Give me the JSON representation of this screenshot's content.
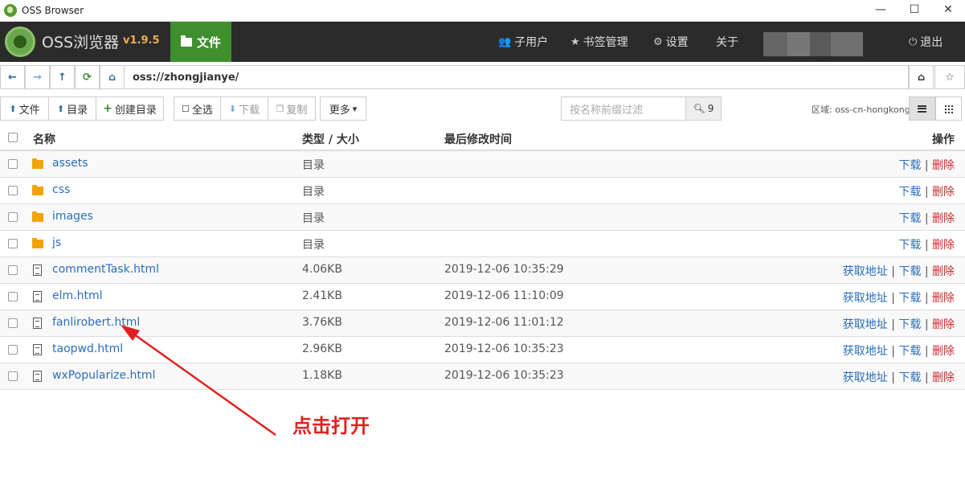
{
  "window": {
    "title": "OSS Browser",
    "controls": [
      "—",
      "☐",
      "✕"
    ]
  },
  "header": {
    "brand": "OSS浏览器",
    "version": "v1.9.5",
    "active_tab": "文件",
    "nav": {
      "subusers": "子用户",
      "bookmarks": "书签管理",
      "settings": "设置",
      "about": "关于",
      "logout": "退出"
    }
  },
  "address": {
    "path": "oss://zhongjianye/"
  },
  "toolbar": {
    "upload_file": "文件",
    "upload_dir": "目录",
    "create_dir": "创建目录",
    "select_all": "全选",
    "download": "下载",
    "copy": "复制",
    "more": "更多",
    "filter_placeholder": "按名称前缀过滤",
    "filter_count": "9",
    "region": "区域: oss-cn-hongkong"
  },
  "table": {
    "headers": {
      "name": "名称",
      "type_size": "类型 / 大小",
      "modified": "最后修改时间",
      "actions": "操作"
    },
    "action_labels": {
      "get_url": "获取地址",
      "download": "下载",
      "delete": "删除",
      "sep": "|"
    },
    "rows": [
      {
        "name": "assets",
        "type_size": "目录",
        "modified": "",
        "kind": "folder"
      },
      {
        "name": "css",
        "type_size": "目录",
        "modified": "",
        "kind": "folder"
      },
      {
        "name": "images",
        "type_size": "目录",
        "modified": "",
        "kind": "folder"
      },
      {
        "name": "js",
        "type_size": "目录",
        "modified": "",
        "kind": "folder"
      },
      {
        "name": "commentTask.html",
        "type_size": "4.06KB",
        "modified": "2019-12-06 10:35:29",
        "kind": "file"
      },
      {
        "name": "elm.html",
        "type_size": "2.41KB",
        "modified": "2019-12-06 11:10:09",
        "kind": "file"
      },
      {
        "name": "fanlirobert.html",
        "type_size": "3.76KB",
        "modified": "2019-12-06 11:01:12",
        "kind": "file"
      },
      {
        "name": "taopwd.html",
        "type_size": "2.96KB",
        "modified": "2019-12-06 10:35:23",
        "kind": "file"
      },
      {
        "name": "wxPopularize.html",
        "type_size": "1.18KB",
        "modified": "2019-12-06 10:35:23",
        "kind": "file"
      }
    ]
  },
  "annotation": {
    "text": "点击打开",
    "color": "#e02020"
  },
  "colors": {
    "header_bg": "#2b2b2b",
    "active_tab": "#3f8f2f",
    "version": "#f0ad4e",
    "link": "#2a6ebb",
    "delete": "#c9302c"
  }
}
